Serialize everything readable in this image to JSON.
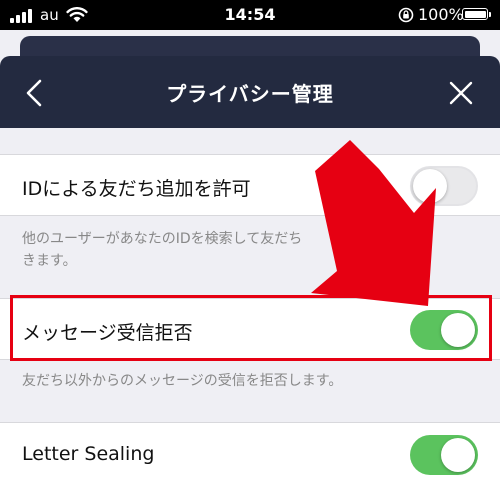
{
  "status_bar": {
    "carrier": "au",
    "time": "14:54",
    "battery_percent": "100%",
    "icons": [
      "signal-icon",
      "wifi-icon",
      "orientation-lock-icon",
      "battery-icon"
    ]
  },
  "header": {
    "title": "プライバシー管理",
    "back_icon": "chevron-left-icon",
    "close_icon": "close-icon"
  },
  "settings": {
    "allow_id_add": {
      "label": "IDによる友だち追加を許可",
      "enabled": false,
      "description_line1": "他のユーザーがあなたのIDを検索して友だち",
      "description_line1_tail": "とがで",
      "description_line2": "きます。"
    },
    "reject_messages": {
      "label": "メッセージ受信拒否",
      "enabled": true,
      "description": "友だち以外からのメッセージの受信を拒否します。"
    },
    "letter_sealing": {
      "label": "Letter Sealing",
      "enabled": true
    }
  },
  "annotation": {
    "arrow_color": "#e60012",
    "highlight_color": "#e60012"
  },
  "colors": {
    "toggle_on": "#5bc35e",
    "navbar": "#232a40"
  }
}
